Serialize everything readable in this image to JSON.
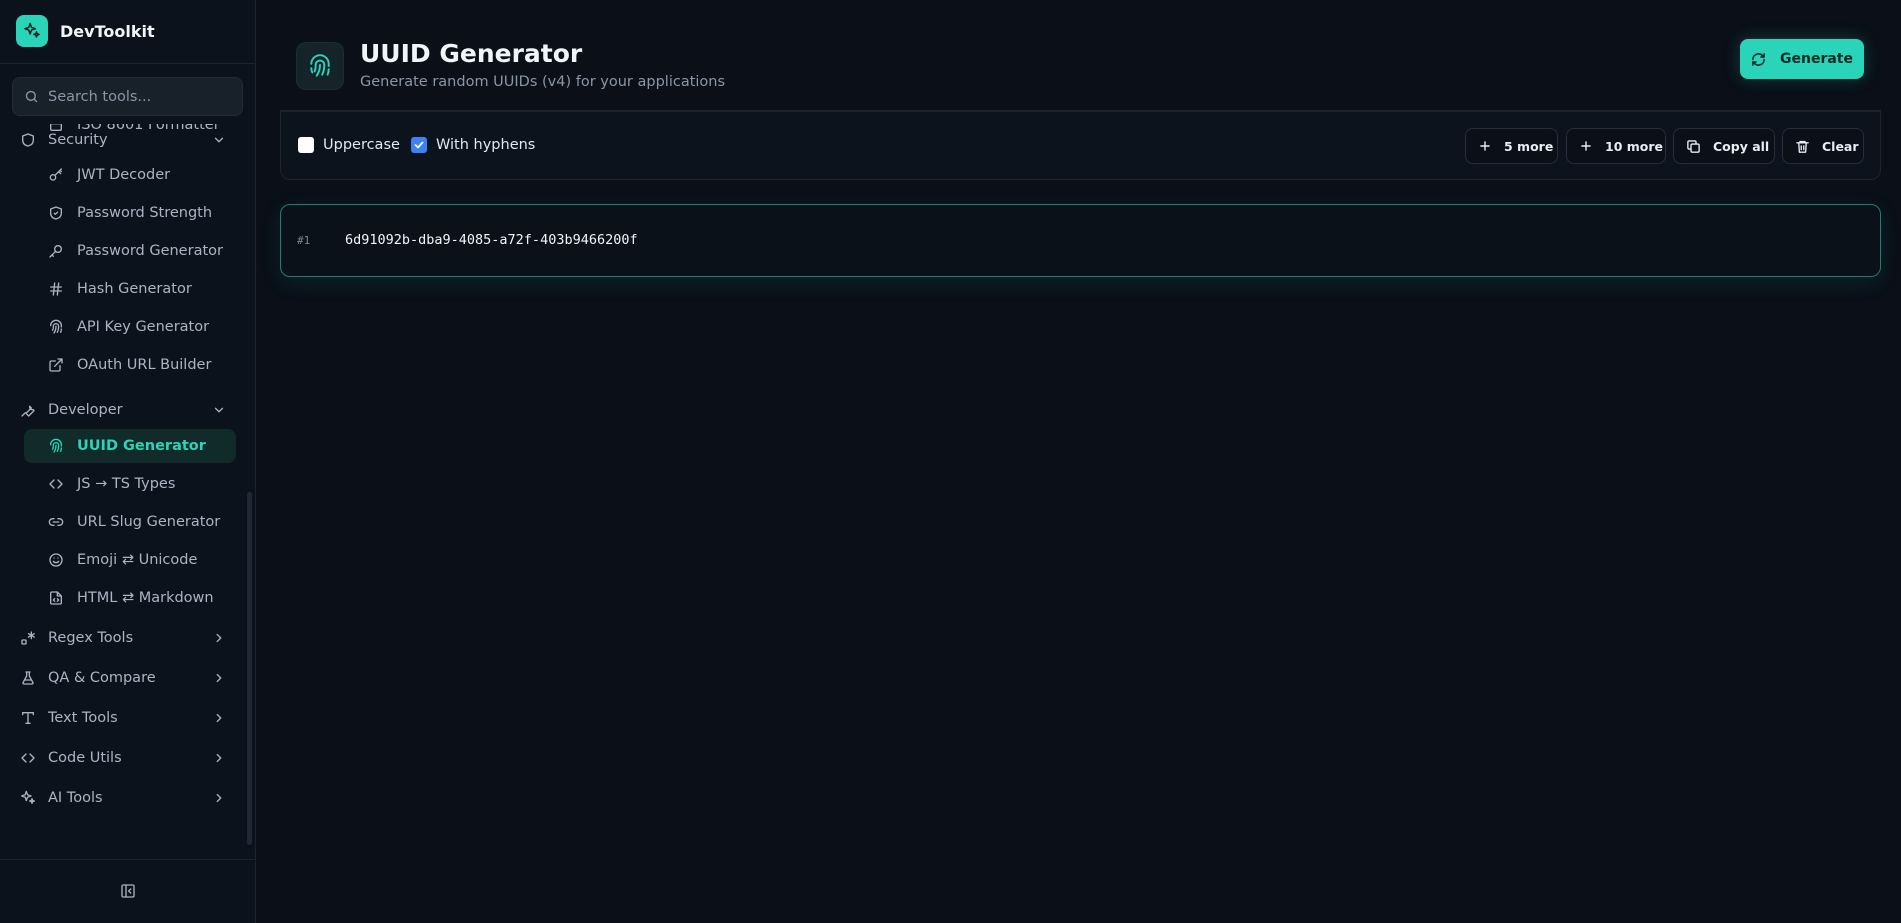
{
  "app": {
    "name": "DevToolkit"
  },
  "search": {
    "placeholder": "Search tools..."
  },
  "nav": {
    "partial_item": "ISO 8601 Formatter",
    "categories": {
      "security": "Security",
      "developer": "Developer",
      "regex": "Regex Tools",
      "qa": "QA & Compare",
      "text": "Text Tools",
      "code": "Code Utils",
      "ai": "AI Tools"
    },
    "security_items": [
      "JWT Decoder",
      "Password Strength",
      "Password Generator",
      "Hash Generator",
      "API Key Generator",
      "OAuth URL Builder"
    ],
    "developer_items": [
      "UUID Generator",
      "JS → TS Types",
      "URL Slug Generator",
      "Emoji ⇄ Unicode",
      "HTML ⇄ Markdown"
    ]
  },
  "page": {
    "title": "UUID Generator",
    "subtitle": "Generate random UUIDs (v4) for your applications",
    "generate_label": "Generate"
  },
  "options": {
    "uppercase": {
      "label": "Uppercase",
      "checked": false
    },
    "hyphens": {
      "label": "With hyphens",
      "checked": true
    }
  },
  "toolbar": {
    "more5": "5 more",
    "more10": "10 more",
    "copy_all": "Copy all",
    "clear": "Clear"
  },
  "results": [
    {
      "index": "#1",
      "value": "6d91092b-dba9-4085-a72f-403b9466200f"
    }
  ],
  "colors": {
    "accent": "#2ad4b9",
    "background": "#0a0f18",
    "checkbox": "#3b82f6"
  }
}
